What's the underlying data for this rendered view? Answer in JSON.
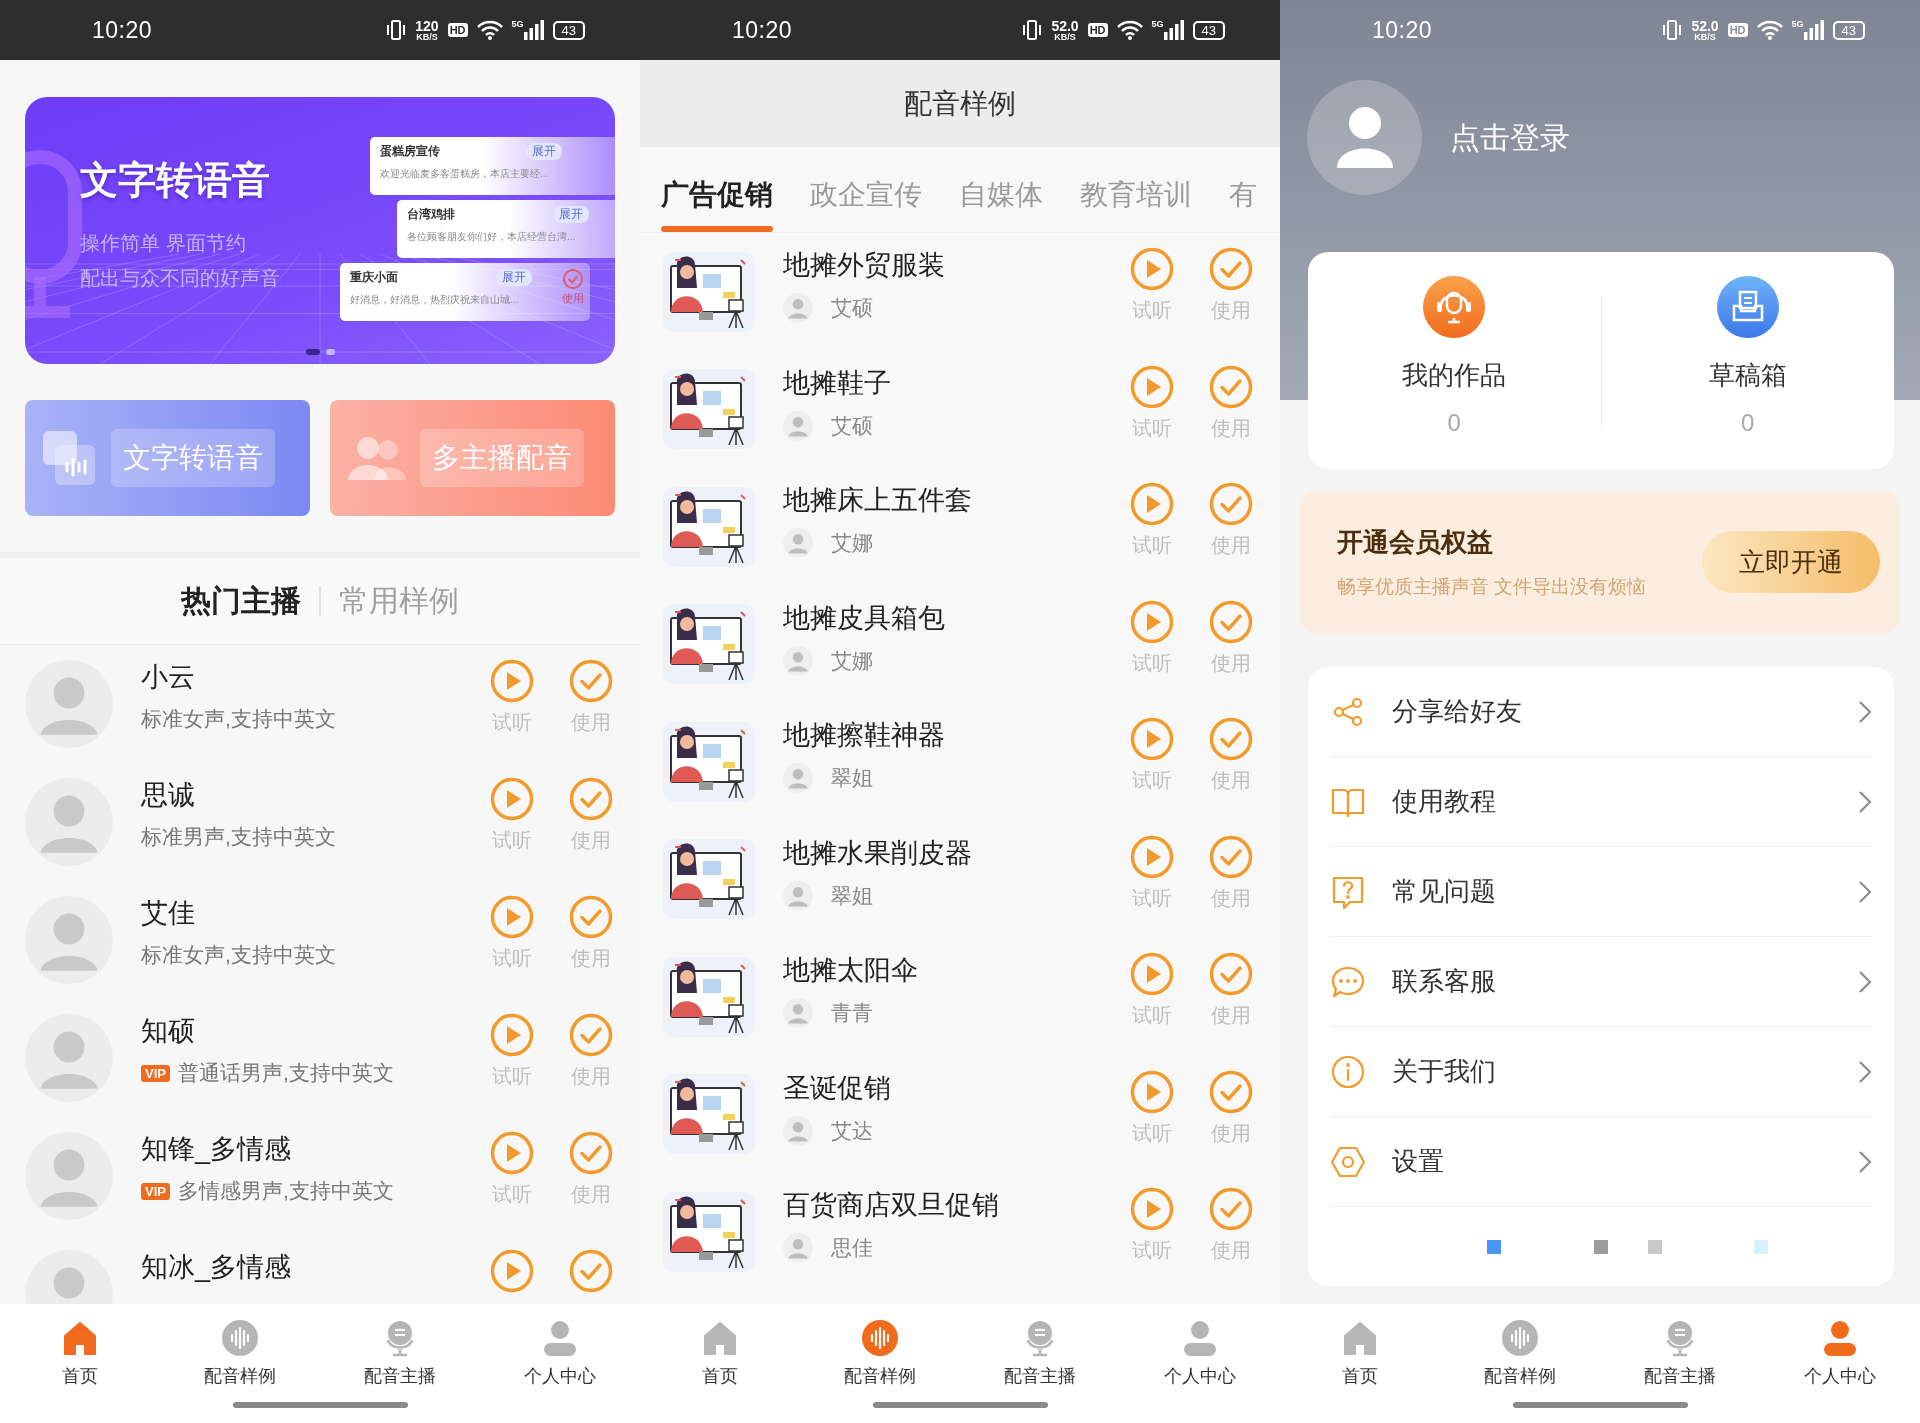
{
  "screens": [
    {
      "kind": "home",
      "status_bar": {
        "time": "10:20",
        "speed": "120",
        "speed_unit": "KB/S",
        "hd": "HD",
        "network": "5G",
        "battery": "43"
      },
      "banner": {
        "title": "文字转语音",
        "lines": [
          "操作简单 界面节约",
          "配出与众不同的好声音"
        ],
        "cards": [
          {
            "title": "蛋糕房宣传",
            "tag": "展开",
            "text": "欢迎光临麦多客蛋糕房，本店主要经..."
          },
          {
            "title": "台湾鸡排",
            "tag": "展开",
            "text": "各位顾客朋友你们好，本店经营台湾..."
          },
          {
            "title": "重庆小面",
            "tag": "展开",
            "text": "好消息，好消息，热烈庆祝来自山城...",
            "action": "使用"
          }
        ],
        "dots": [
          {
            "selected": true
          },
          {
            "selected": false
          }
        ]
      },
      "features": [
        {
          "kind": "tts",
          "label": "文字转语音"
        },
        {
          "kind": "multi",
          "label": "多主播配音"
        }
      ],
      "section_tabs": [
        {
          "label": "热门主播",
          "selected": true
        },
        {
          "label": "常用样例",
          "selected": false
        }
      ],
      "anchors": [
        {
          "name": "小云",
          "description": "标准女声,支持中英文",
          "play_label": "试听",
          "use_label": "使用"
        },
        {
          "name": "思诚",
          "description": "标准男声,支持中英文",
          "play_label": "试听",
          "use_label": "使用"
        },
        {
          "name": "艾佳",
          "description": "标准女声,支持中英文",
          "play_label": "试听",
          "use_label": "使用"
        },
        {
          "name": "知硕",
          "badge": "VIP",
          "description": "普通话男声,支持中英文",
          "play_label": "试听",
          "use_label": "使用"
        },
        {
          "name": "知锋_多情感",
          "badge": "VIP",
          "description": "多情感男声,支持中英文",
          "play_label": "试听",
          "use_label": "使用"
        },
        {
          "name": "知冰_多情感"
        }
      ],
      "nav": [
        {
          "kind": "home",
          "label": "首页",
          "selected": true
        },
        {
          "kind": "samples",
          "label": "配音样例",
          "selected": false
        },
        {
          "kind": "anchors",
          "label": "配音主播",
          "selected": false
        },
        {
          "kind": "profile",
          "label": "个人中心",
          "selected": false
        }
      ]
    },
    {
      "kind": "samples",
      "status_bar": {
        "time": "10:20",
        "speed": "52.0",
        "speed_unit": "KB/S",
        "hd": "HD",
        "network": "5G",
        "battery": "43"
      },
      "title": "配音样例",
      "tabs": [
        {
          "label": "广告促销",
          "selected": true
        },
        {
          "label": "政企宣传",
          "selected": false
        },
        {
          "label": "自媒体",
          "selected": false
        },
        {
          "label": "教育培训",
          "selected": false
        },
        {
          "label": "有",
          "selected": false
        }
      ],
      "samples": [
        {
          "title": "地摊外贸服装",
          "voice": "艾硕",
          "play_label": "试听",
          "use_label": "使用"
        },
        {
          "title": "地摊鞋子",
          "voice": "艾硕",
          "play_label": "试听",
          "use_label": "使用"
        },
        {
          "title": "地摊床上五件套",
          "voice": "艾娜",
          "play_label": "试听",
          "use_label": "使用"
        },
        {
          "title": "地摊皮具箱包",
          "voice": "艾娜",
          "play_label": "试听",
          "use_label": "使用"
        },
        {
          "title": "地摊擦鞋神器",
          "voice": "翠姐",
          "play_label": "试听",
          "use_label": "使用"
        },
        {
          "title": "地摊水果削皮器",
          "voice": "翠姐",
          "play_label": "试听",
          "use_label": "使用"
        },
        {
          "title": "地摊太阳伞",
          "voice": "青青",
          "play_label": "试听",
          "use_label": "使用"
        },
        {
          "title": "圣诞促销",
          "voice": "艾达",
          "play_label": "试听",
          "use_label": "使用"
        },
        {
          "title": "百货商店双旦促销",
          "voice": "思佳",
          "play_label": "试听",
          "use_label": "使用"
        }
      ],
      "nav": [
        {
          "kind": "home",
          "label": "首页",
          "selected": false
        },
        {
          "kind": "samples",
          "label": "配音样例",
          "selected": true
        },
        {
          "kind": "anchors",
          "label": "配音主播",
          "selected": false
        },
        {
          "kind": "profile",
          "label": "个人中心",
          "selected": false
        }
      ]
    },
    {
      "kind": "profile",
      "status_bar": {
        "time": "10:20",
        "speed": "52.0",
        "speed_unit": "KB/S",
        "hd": "HD",
        "network": "5G",
        "battery": "43"
      },
      "login": "点击登录",
      "stats": [
        {
          "kind": "works",
          "label": "我的作品",
          "count": "0"
        },
        {
          "kind": "drafts",
          "label": "草稿箱",
          "count": "0"
        }
      ],
      "vip": {
        "title": "开通会员权益",
        "subtitle": "畅享优质主播声音 文件导出没有烦恼",
        "button": "立即开通"
      },
      "menu": [
        {
          "kind": "share",
          "label": "分享给好友"
        },
        {
          "kind": "tutorial",
          "label": "使用教程"
        },
        {
          "kind": "faq",
          "label": "常见问题"
        },
        {
          "kind": "service",
          "label": "联系客服"
        },
        {
          "kind": "about",
          "label": "关于我们"
        },
        {
          "kind": "settings",
          "label": "设置"
        }
      ],
      "dots": [
        {
          "color": "#4a94f5"
        },
        {
          "color": "#9c9c9c"
        },
        {
          "color": "#c9c9c9"
        },
        {
          "color": "#d9f1fc"
        }
      ],
      "nav": [
        {
          "kind": "home",
          "label": "首页",
          "selected": false
        },
        {
          "kind": "samples",
          "label": "配音样例",
          "selected": false
        },
        {
          "kind": "anchors",
          "label": "配音主播",
          "selected": false
        },
        {
          "kind": "profile",
          "label": "个人中心",
          "selected": true
        }
      ]
    }
  ]
}
